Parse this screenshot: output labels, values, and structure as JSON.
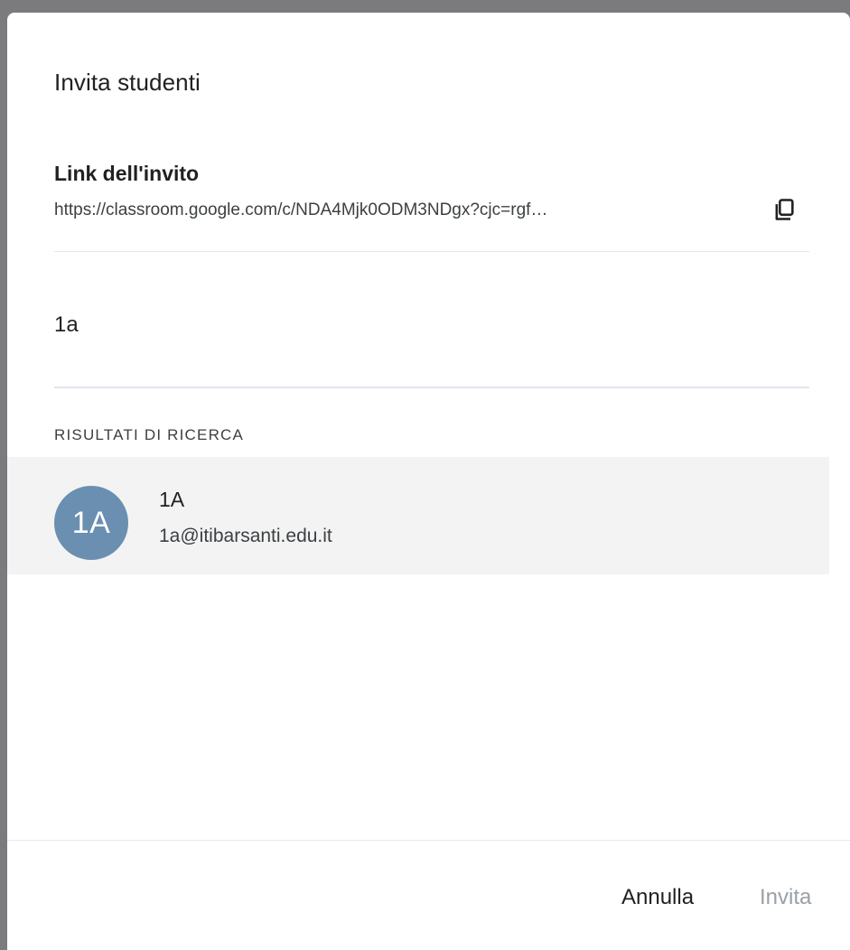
{
  "dialog": {
    "title": "Invita studenti"
  },
  "invite_link": {
    "heading": "Link dell'invito",
    "url": "https://classroom.google.com/c/NDA4Mjk0ODM3NDgx?cjc=rgf…",
    "copy_icon": "copy-icon"
  },
  "search": {
    "value": "1a"
  },
  "results": {
    "label": "RISULTATI DI RICERCA",
    "items": [
      {
        "avatar_text": "1A",
        "name": "1A",
        "email": "1a@itibarsanti.edu.it",
        "avatar_color": "#6a8fb0"
      }
    ]
  },
  "actions": {
    "cancel_label": "Annulla",
    "invite_label": "Invita"
  }
}
